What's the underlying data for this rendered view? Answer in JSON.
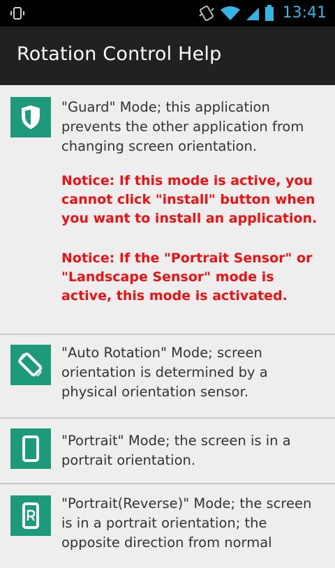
{
  "status_bar": {
    "time": "13:41",
    "icons": [
      "screen-rotation-icon",
      "vibrate-icon",
      "wifi-icon",
      "signal-icon",
      "battery-icon"
    ],
    "accent_color": "#33b5e5"
  },
  "app_bar": {
    "title": "Rotation Control Help",
    "background": "#212121"
  },
  "items": [
    {
      "icon": "shield-icon",
      "desc": "\"Guard\" Mode; this application prevents the other application from changing screen orientation.",
      "notices": [
        "Notice: If this mode is active, you cannot click \"install\" button when you want to install an application.",
        "Notice: If the \"Portrait Sensor\" or \"Landscape Sensor\" mode is active, this mode is activated."
      ]
    },
    {
      "icon": "auto-rotate-icon",
      "desc": "\"Auto Rotation\" Mode; screen orientation is determined by a physical orientation sensor."
    },
    {
      "icon": "portrait-phone-icon",
      "desc": "\"Portrait\" Mode; the screen is in a portrait orientation."
    },
    {
      "icon": "portrait-reverse-icon",
      "desc": "\"Portrait(Reverse)\" Mode; the screen is in a portrait orientation; the opposite direction from normal"
    }
  ],
  "colors": {
    "icon_tile": "#1c9a7a",
    "notice_text": "#ee1111",
    "list_background": "#eeeeee"
  }
}
